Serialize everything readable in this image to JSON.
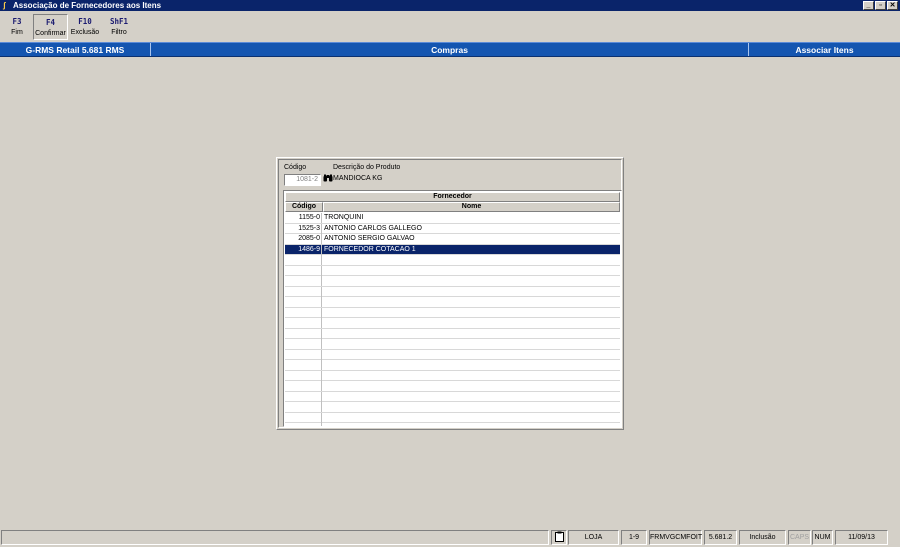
{
  "window": {
    "title": "Associação de Fornecedores aos Itens",
    "buttons": {
      "minimize": "_",
      "restore": "▫",
      "close": "✕"
    }
  },
  "toolbar": {
    "keys": [
      {
        "key": "F3",
        "label": "Fim"
      },
      {
        "key": "F4",
        "label": "Confirmar"
      },
      {
        "key": "F10",
        "label": "Exclusão"
      },
      {
        "key": "ShF1",
        "label": "Filtro"
      }
    ]
  },
  "infobar": {
    "system": "G-RMS Retail 5.681 RMS",
    "module": "Compras",
    "action": "Associar Itens"
  },
  "product": {
    "codigo_label": "Código",
    "descricao_label": "Descrição do Produto",
    "codigo_value": "1081-2",
    "descricao_value": "MANDIOCA KG",
    "lookup_icon": "binoculars-icon"
  },
  "grid": {
    "group_header": "Fornecedor",
    "columns": [
      "Código",
      "Nome"
    ],
    "rows": [
      {
        "codigo": "1155-0",
        "nome": "TRONQUINI"
      },
      {
        "codigo": "1525-3",
        "nome": "ANTONIO CARLOS GALLEGO"
      },
      {
        "codigo": "2085-0",
        "nome": "ANTONIO SERGIO GALVAO"
      },
      {
        "codigo": "1486-9",
        "nome": "FORNECEDOR COTACAO 1"
      }
    ],
    "selected_index": 3
  },
  "statusbar": {
    "loja": "LOJA",
    "page": "1-9",
    "form": "FRMVGCMFOIT",
    "version": "5.681.2",
    "mode": "Inclusão",
    "caps": "CAPS",
    "num": "NUM",
    "date": "11/09/13",
    "icon": "clipboard-icon"
  },
  "colors": {
    "titlebar": "#0a246a",
    "infobar": "#1455b0",
    "selection": "#0a246a",
    "background": "#d4d0c8"
  }
}
